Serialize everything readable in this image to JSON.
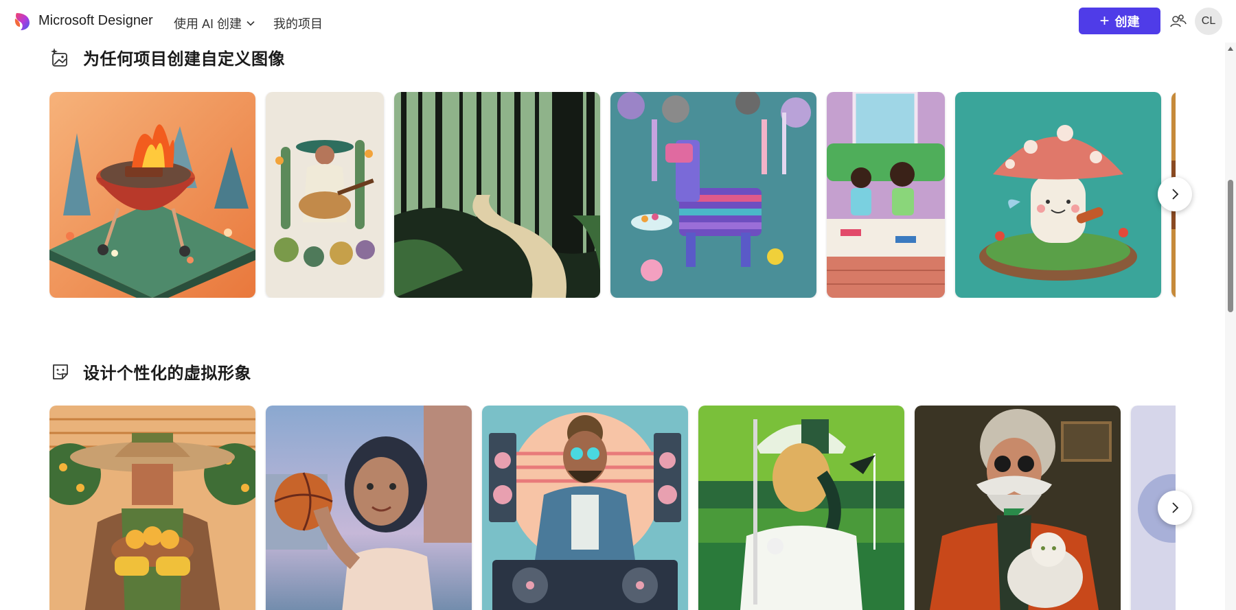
{
  "header": {
    "brand": "Microsoft Designer",
    "nav_ai": "使用 AI 创建",
    "nav_projects": "我的项目",
    "create_label": "创建",
    "avatar_initials": "CL",
    "accent_color": "#4f3ce8"
  },
  "sections": [
    {
      "title": "为任何项目创建自定义图像",
      "icon": "image-sparkle-icon",
      "tiles": [
        "bbq-grill-image",
        "cactus-guitarist-image",
        "forest-path-image",
        "pinata-party-image",
        "kids-reading-image",
        "mushroom-violinist-image",
        "partial-image"
      ]
    },
    {
      "title": "设计个性化的虚拟形象",
      "icon": "sticker-smile-icon",
      "tiles": [
        "orange-farmer-avatar",
        "basketball-girl-avatar",
        "dj-avatar",
        "golfer-avatar",
        "mustache-cat-avatar",
        "partial-avatar"
      ]
    }
  ]
}
